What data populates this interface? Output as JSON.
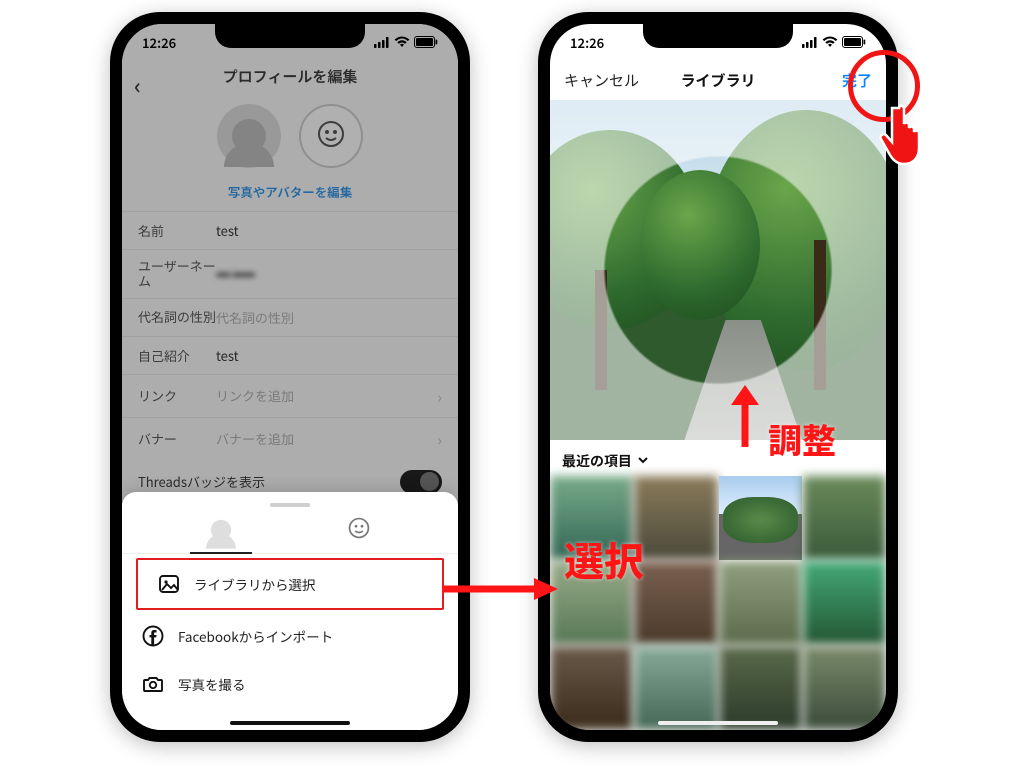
{
  "status": {
    "time": "12:26"
  },
  "left": {
    "title": "プロフィールを編集",
    "edit_avatar_link": "写真やアバターを編集",
    "fields": {
      "name_label": "名前",
      "name_value": "test",
      "username_label": "ユーザーネーム",
      "username_value": "••• •••••",
      "pronouns_label": "代名詞の性別",
      "pronouns_placeholder": "代名詞の性別",
      "bio_label": "自己紹介",
      "bio_value": "test",
      "link_label": "リンク",
      "link_placeholder": "リンクを追加",
      "banner_label": "バナー",
      "banner_placeholder": "バナーを追加",
      "threads_label": "Threadsバッジを表示"
    },
    "sheet": {
      "option_library": "ライブラリから選択",
      "option_facebook": "Facebookからインポート",
      "option_camera": "写真を撮る"
    }
  },
  "right": {
    "cancel": "キャンセル",
    "title": "ライブラリ",
    "done": "完了",
    "album_selector": "最近の項目"
  },
  "annotations": {
    "adjust_label": "調整",
    "select_label": "選択"
  }
}
